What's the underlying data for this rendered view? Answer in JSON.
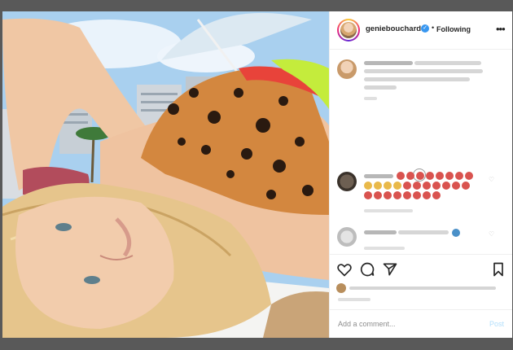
{
  "post": {
    "username": "geniebouchard",
    "separator": "•",
    "follow_status": "Following",
    "more_icon": "ellipsis-horizontal-icon",
    "verified_icon": "verified-badge-icon"
  },
  "comments": {
    "load_more_icon": "plus-circle-icon"
  },
  "actions": {
    "like_icon": "heart-outline-icon",
    "comment_icon": "comment-bubble-icon",
    "share_icon": "paper-plane-icon",
    "save_icon": "bookmark-outline-icon"
  },
  "composer": {
    "placeholder": "Add a comment...",
    "post_label": "Post"
  },
  "colors": {
    "accent_blue": "#3897f0",
    "post_disabled": "#b2dffc",
    "text_primary": "#262626",
    "text_secondary": "#8e8e8e"
  }
}
